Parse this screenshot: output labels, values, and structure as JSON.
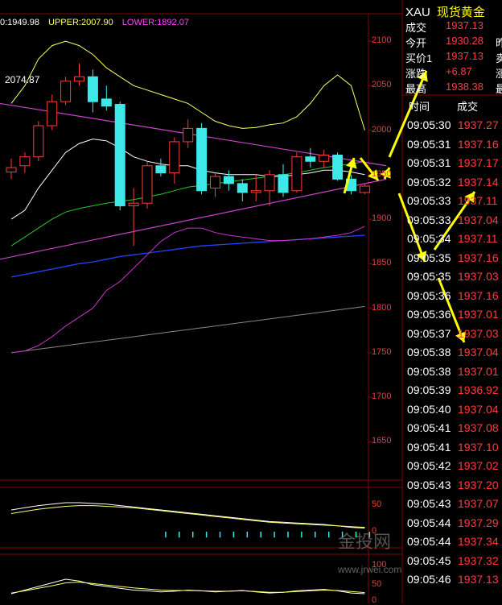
{
  "legend": {
    "mid": "0:1949.98",
    "upper": "UPPER:2007.90",
    "lower": "LOWER:1892.07"
  },
  "high_label": "2074.87",
  "y_axis_main": [
    "2100",
    "2050",
    "2000",
    "1950",
    "1900",
    "1850",
    "1800",
    "1750",
    "1700",
    "1650"
  ],
  "y_axis_macd": [
    "50",
    "0"
  ],
  "y_axis_kdj": [
    "100",
    "50",
    "0"
  ],
  "quote": {
    "symbol": "XAU",
    "name": "现货黄金",
    "rows": [
      {
        "label": "成交",
        "value": "1937.13",
        "extra": ""
      },
      {
        "label": "今开",
        "value": "1930.28",
        "extra": "昨"
      },
      {
        "label": "买价1",
        "value": "1937.13",
        "extra": "卖"
      },
      {
        "label": "涨跌",
        "value": "+6.87",
        "extra": "涨"
      },
      {
        "label": "最高",
        "value": "1938.38",
        "extra": "最"
      }
    ],
    "tick_headers": [
      "时间",
      "成交"
    ],
    "ticks": [
      {
        "time": "09:05:30",
        "price": "1937.27"
      },
      {
        "time": "09:05:31",
        "price": "1937.16"
      },
      {
        "time": "09:05:31",
        "price": "1937.17"
      },
      {
        "time": "09:05:32",
        "price": "1937.14"
      },
      {
        "time": "09:05:33",
        "price": "1937.11"
      },
      {
        "time": "09:05:33",
        "price": "1937.04"
      },
      {
        "time": "09:05:34",
        "price": "1937.11"
      },
      {
        "time": "09:05:35",
        "price": "1937.16"
      },
      {
        "time": "09:05:35",
        "price": "1937.03"
      },
      {
        "time": "09:05:36",
        "price": "1937.16"
      },
      {
        "time": "09:05:36",
        "price": "1937.01"
      },
      {
        "time": "09:05:37",
        "price": "1937.03"
      },
      {
        "time": "09:05:38",
        "price": "1937.04"
      },
      {
        "time": "09:05:38",
        "price": "1937.01"
      },
      {
        "time": "09:05:39",
        "price": "1936.92"
      },
      {
        "time": "09:05:40",
        "price": "1937.04"
      },
      {
        "time": "09:05:41",
        "price": "1937.08"
      },
      {
        "time": "09:05:41",
        "price": "1937.10"
      },
      {
        "time": "09:05:42",
        "price": "1937.02"
      },
      {
        "time": "09:05:43",
        "price": "1937.20"
      },
      {
        "time": "09:05:43",
        "price": "1937.07"
      },
      {
        "time": "09:05:44",
        "price": "1937.29"
      },
      {
        "time": "09:05:44",
        "price": "1937.34"
      },
      {
        "time": "09:05:45",
        "price": "1937.32"
      },
      {
        "time": "09:05:46",
        "price": "1937.13"
      }
    ]
  },
  "watermark": {
    "text": "金投网",
    "url": "www.jrwei.com"
  },
  "colors": {
    "up": "#ff3b3b",
    "down": "#3ee8e8",
    "upper_band": "#ffff66",
    "lower_band": "#cc33cc",
    "ma_green": "#22cc22",
    "ma_blue": "#2244ff",
    "ma_gray": "#888888",
    "trendline": "#cc44cc",
    "arrow": "#ffff00",
    "grid": "#8b0000"
  },
  "chart_data": {
    "type": "candlestick",
    "y_range": [
      1625,
      2110
    ],
    "candles": [
      {
        "o": 1953,
        "h": 1968,
        "l": 1945,
        "c": 1958
      },
      {
        "o": 1960,
        "h": 1975,
        "l": 1952,
        "c": 1970
      },
      {
        "o": 1970,
        "h": 2010,
        "l": 1965,
        "c": 2005
      },
      {
        "o": 2005,
        "h": 2040,
        "l": 2000,
        "c": 2032
      },
      {
        "o": 2032,
        "h": 2060,
        "l": 2028,
        "c": 2055
      },
      {
        "o": 2055,
        "h": 2074.87,
        "l": 2050,
        "c": 2060
      },
      {
        "o": 2060,
        "h": 2068,
        "l": 2020,
        "c": 2032
      },
      {
        "o": 2035,
        "h": 2050,
        "l": 2022,
        "c": 2027
      },
      {
        "o": 2029,
        "h": 2032,
        "l": 1910,
        "c": 1915
      },
      {
        "o": 1915,
        "h": 1935,
        "l": 1870,
        "c": 1918
      },
      {
        "o": 1918,
        "h": 1965,
        "l": 1912,
        "c": 1960
      },
      {
        "o": 1960,
        "h": 1968,
        "l": 1948,
        "c": 1952
      },
      {
        "o": 1952,
        "h": 1992,
        "l": 1940,
        "c": 1987
      },
      {
        "o": 1987,
        "h": 2012,
        "l": 1980,
        "c": 2002
      },
      {
        "o": 2002,
        "h": 2008,
        "l": 1928,
        "c": 1932
      },
      {
        "o": 1935,
        "h": 1952,
        "l": 1925,
        "c": 1948
      },
      {
        "o": 1948,
        "h": 1955,
        "l": 1932,
        "c": 1940
      },
      {
        "o": 1940,
        "h": 1945,
        "l": 1920,
        "c": 1930
      },
      {
        "o": 1930,
        "h": 1950,
        "l": 1920,
        "c": 1932
      },
      {
        "o": 1932,
        "h": 1955,
        "l": 1915,
        "c": 1950
      },
      {
        "o": 1950,
        "h": 1962,
        "l": 1925,
        "c": 1930
      },
      {
        "o": 1932,
        "h": 1975,
        "l": 1930,
        "c": 1970
      },
      {
        "o": 1970,
        "h": 1980,
        "l": 1958,
        "c": 1965
      },
      {
        "o": 1965,
        "h": 1978,
        "l": 1958,
        "c": 1972
      },
      {
        "o": 1972,
        "h": 1975,
        "l": 1943,
        "c": 1945
      },
      {
        "o": 1945,
        "h": 1950,
        "l": 1928,
        "c": 1932
      },
      {
        "o": 1930,
        "h": 1940,
        "l": 1928,
        "c": 1937.13
      }
    ],
    "upper_band": [
      2030,
      2050,
      2080,
      2095,
      2100,
      2095,
      2085,
      2070,
      2060,
      2050,
      2045,
      2040,
      2035,
      2030,
      2020,
      2010,
      2005,
      2002,
      2003,
      2006,
      2008,
      2015,
      2030,
      2050,
      2062,
      2050,
      2000
    ],
    "mid_band": [
      1900,
      1910,
      1935,
      1955,
      1975,
      1985,
      1990,
      1988,
      1980,
      1970,
      1965,
      1962,
      1960,
      1960,
      1955,
      1952,
      1950,
      1950,
      1950,
      1948,
      1948,
      1950,
      1952,
      1955,
      1955,
      1953,
      1950
    ],
    "lower_band": [
      1750,
      1752,
      1758,
      1768,
      1780,
      1790,
      1800,
      1820,
      1830,
      1845,
      1860,
      1875,
      1885,
      1890,
      1890,
      1885,
      1882,
      1880,
      1878,
      1876,
      1876,
      1877,
      1878,
      1880,
      1882,
      1885,
      1892
    ],
    "ma_green": [
      1870,
      1880,
      1890,
      1900,
      1908,
      1912,
      1915,
      1918,
      1920,
      1922,
      1925,
      1928,
      1932,
      1936,
      1938,
      1940,
      1942,
      1944,
      1946,
      1948,
      1950,
      1952,
      1955,
      1958,
      1960,
      1962,
      1965
    ],
    "ma_blue": [
      1835,
      1838,
      1841,
      1844,
      1847,
      1850,
      1852,
      1855,
      1858,
      1860,
      1862,
      1864,
      1866,
      1868,
      1870,
      1871,
      1872,
      1873,
      1874,
      1875,
      1876,
      1877,
      1878,
      1879,
      1880,
      1881,
      1882
    ],
    "ma_gray": [
      1750,
      1752,
      1754,
      1756,
      1758,
      1760,
      1762,
      1764,
      1766,
      1768,
      1770,
      1772,
      1774,
      1776,
      1778,
      1780,
      1782,
      1784,
      1786,
      1788,
      1790,
      1792,
      1794,
      1796,
      1798,
      1800,
      1802
    ],
    "trend_upper": [
      [
        0,
        2030
      ],
      [
        27,
        1960
      ]
    ],
    "trend_lower": [
      [
        0,
        1855
      ],
      [
        27,
        1945
      ]
    ],
    "macd_hist": [
      0,
      0,
      0,
      0,
      0,
      0,
      0,
      0,
      0,
      0,
      0,
      -8,
      -8,
      -8,
      -8,
      -8,
      -8,
      -8,
      -8,
      -8,
      -8,
      -8,
      -8,
      -8,
      -8,
      -8,
      -8
    ],
    "macd_dif": [
      30,
      33,
      36,
      38,
      40,
      40,
      39,
      38,
      36,
      34,
      32,
      30,
      28,
      26,
      24,
      22,
      20,
      18,
      16,
      14,
      13,
      12,
      11,
      10,
      8,
      6,
      5
    ],
    "macd_dea": [
      25,
      28,
      31,
      33,
      35,
      36,
      36,
      35,
      34,
      33,
      31,
      29,
      27,
      25,
      23,
      21,
      19,
      17,
      15,
      13,
      12,
      11,
      10,
      9,
      8,
      7,
      6
    ],
    "kdj_k": [
      20,
      30,
      40,
      50,
      60,
      55,
      45,
      40,
      35,
      30,
      28,
      25,
      27,
      30,
      28,
      25,
      27,
      29,
      25,
      22,
      24,
      28,
      30,
      32,
      28,
      22,
      20
    ],
    "kdj_d": [
      22,
      28,
      35,
      42,
      50,
      52,
      48,
      44,
      40,
      36,
      33,
      30,
      29,
      29,
      28,
      27,
      27,
      28,
      26,
      24,
      24,
      26,
      28,
      30,
      29,
      26,
      23
    ]
  }
}
